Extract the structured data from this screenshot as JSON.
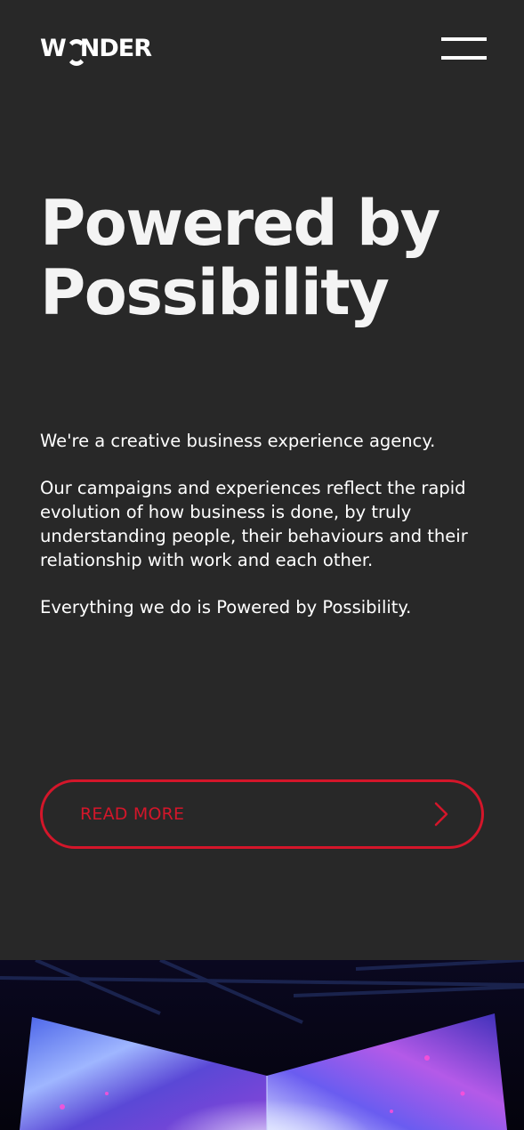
{
  "header": {
    "logo_left": "W",
    "logo_right": "NDER",
    "menu_icon": "hamburger-menu-icon"
  },
  "hero": {
    "title_line1": "Powered by",
    "title_line2": "Possibility"
  },
  "intro": {
    "p1": "We're a creative business experience agency.",
    "p2": "Our campaigns and experiences reflect the rapid evolution of how business is done, by truly understanding people, their behaviours and their relationship with work and each other.",
    "p3": "Everything we do is Powered by Possibility."
  },
  "cta": {
    "label": "READ MORE",
    "icon": "chevron-right-icon"
  },
  "colors": {
    "background": "#282828",
    "text": "#ffffff",
    "accent": "#d4162a"
  }
}
